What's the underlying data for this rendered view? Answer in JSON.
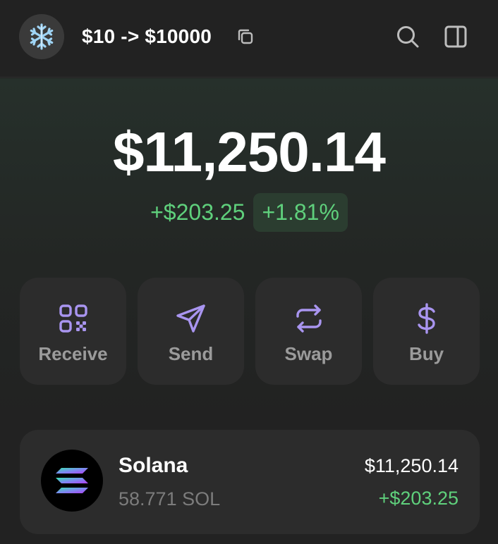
{
  "header": {
    "avatar_emoji": "❄",
    "account_name": "$10 -> $10000",
    "icons": [
      "snowflake-icon",
      "copy-icon",
      "search-icon",
      "panel-icon"
    ]
  },
  "balance": {
    "total": "$11,250.14",
    "change_abs": "+$203.25",
    "change_pct": "+1.81%"
  },
  "actions": [
    {
      "label": "Receive",
      "icon": "qr-code-icon"
    },
    {
      "label": "Send",
      "icon": "send-icon"
    },
    {
      "label": "Swap",
      "icon": "swap-icon"
    },
    {
      "label": "Buy",
      "icon": "dollar-icon"
    }
  ],
  "tokens": [
    {
      "name": "Solana",
      "amount": "58.771 SOL",
      "value": "$11,250.14",
      "change": "+$203.25"
    }
  ],
  "colors": {
    "accent": "#a995f0",
    "positive": "#5fd07c",
    "background": "#222222",
    "card": "#2c2c2c"
  }
}
